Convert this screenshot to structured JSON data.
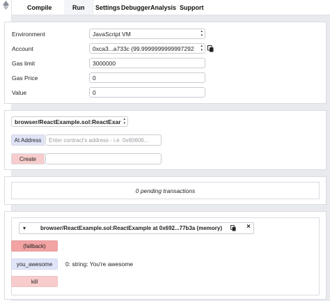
{
  "tabs": [
    "Compile",
    "Run",
    "Settings",
    "Debugger",
    "Analysis",
    "Support"
  ],
  "config": {
    "environment_label": "Environment",
    "environment_value": "JavaScript VM",
    "account_label": "Account",
    "account_value": "0xca3...a733c (99.9999999999997292",
    "gas_limit_label": "Gas limit",
    "gas_limit_value": "3000000",
    "gas_price_label": "Gas Price",
    "gas_price_value": "0",
    "value_label": "Value",
    "value_value": "0"
  },
  "deploy": {
    "contract_select": "browser/ReactExample.sol:ReactExar",
    "at_address_label": "At Address",
    "at_address_placeholder": "Enter contract's address - i.e. 0x60606...",
    "create_label": "Create",
    "create_input_value": ""
  },
  "pending": {
    "text": "0 pending transactions"
  },
  "instance": {
    "caret": "▾",
    "title": "browser/ReactExample.sol:ReactExample at 0x692...77b3a (memory)",
    "close": "×",
    "functions": [
      {
        "label": "(fallback)",
        "color": "#f2a3a3"
      },
      {
        "label": "you_awesome",
        "color": "#e0e4f8"
      },
      {
        "label": "kill",
        "color": "#f8cccc"
      }
    ],
    "result": "0: string: You're awesome"
  },
  "colors": {
    "create_button": "#f8cccc",
    "at_address_button": "#e0e4f8"
  }
}
